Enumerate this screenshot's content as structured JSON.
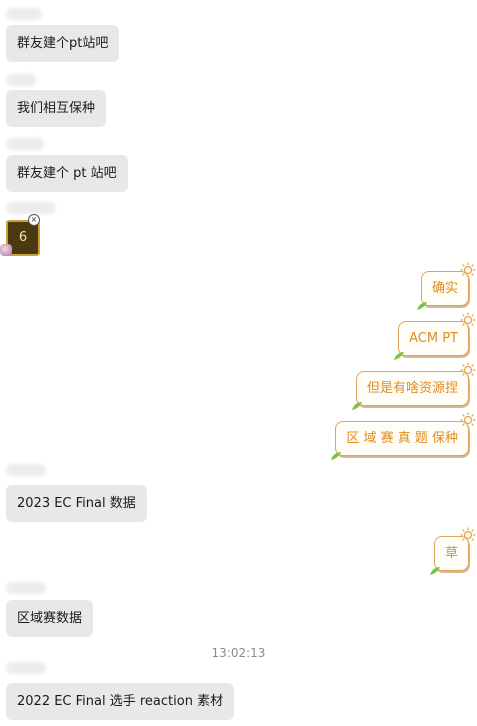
{
  "messages_in": [
    {
      "text": "群友建个pt站吧"
    },
    {
      "text": "我们相互保种"
    },
    {
      "text": "群友建个 pt 站吧"
    },
    {
      "text": "2023 EC Final 数据"
    },
    {
      "text": "区域赛数据"
    },
    {
      "text": "2022 EC Final 选手 reaction 素材"
    }
  ],
  "sticker": {
    "text": "6"
  },
  "messages_out": [
    {
      "text": "确实"
    },
    {
      "text": "ACM PT"
    },
    {
      "text": "但是有啥资源捏"
    },
    {
      "text": "区 域 赛 真 题 保种"
    },
    {
      "text": "草"
    }
  ],
  "timestamp": "13:02:13",
  "colors": {
    "incoming_bubble": "#e8e8e8",
    "outgoing_text": "#e08c1e",
    "outgoing_border": "#e0a45a"
  }
}
